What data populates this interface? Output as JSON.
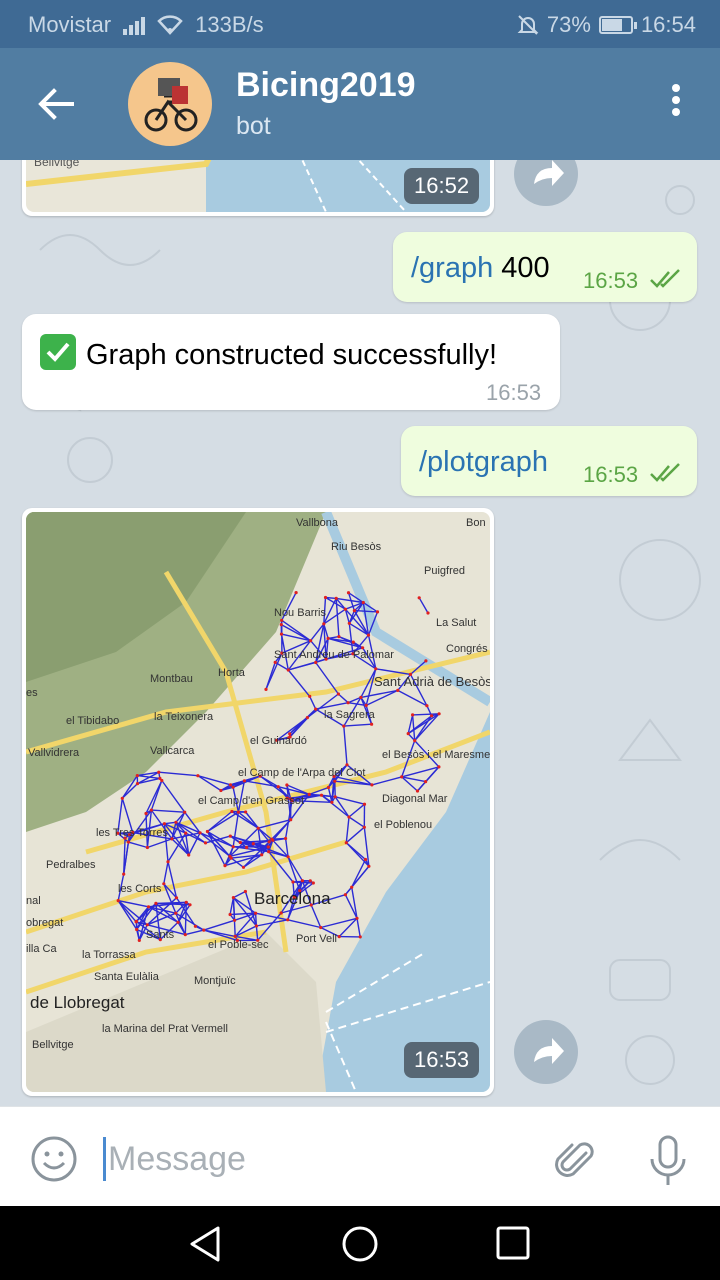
{
  "status": {
    "carrier": "Movistar",
    "speed": "133B/s",
    "battery": "73%",
    "battery_level": 0.73,
    "time": "16:54",
    "icons": [
      "signal-icon",
      "wifi-icon",
      "mute-icon",
      "battery-icon"
    ]
  },
  "header": {
    "title": "Bicing2019",
    "subtitle": "bot"
  },
  "messages": [
    {
      "type": "photo-in",
      "time": "16:52",
      "map_label": "Bellvitge"
    },
    {
      "type": "out",
      "command": "/graph",
      "arg": " 400",
      "time": "16:53"
    },
    {
      "type": "in",
      "emoji": "check-mark-icon",
      "text": "Graph constructed successfully!",
      "time": "16:53"
    },
    {
      "type": "out",
      "command": "/plotgraph",
      "arg": "",
      "time": "16:53"
    },
    {
      "type": "photo-in",
      "time": "16:53",
      "map_labels": [
        "Vallbona",
        "Riu Besòs",
        "Puigfred",
        "Nou Barris",
        "La Salut",
        "Congrés",
        "Sant Andreu de Palomar",
        "Montbau",
        "Horta",
        "Sant Adrià de Besòs",
        "es",
        "el Tibidabo",
        "la Teixonera",
        "la Sagrera",
        "Vallvidrera",
        "Vallcarca",
        "el Guinardó",
        "el Besòs i el Maresme",
        "el Camp de l'Arpa del Clot",
        "el Camp d'en Grassot",
        "Diagonal Mar",
        "les Tres Torres",
        "el Poblenou",
        "Pedralbes",
        "les Corts",
        "Barcelona",
        "nal",
        "obregat",
        "Sants",
        "el Poble-sec",
        "Port Vell",
        "illa Ca",
        "la Torrassa",
        "Santa Eulàlia",
        "Montjuïc",
        "de Llobregat",
        "la Marina del Prat Vermell",
        "Bellvitge",
        "Bon"
      ]
    }
  ],
  "input": {
    "placeholder": "Message"
  },
  "colors": {
    "header": "#517da2",
    "statusbar": "#3f6a94",
    "outgoing_bubble": "#effdde",
    "command_link": "#2a73b2",
    "time_outgoing": "#5ba545"
  }
}
